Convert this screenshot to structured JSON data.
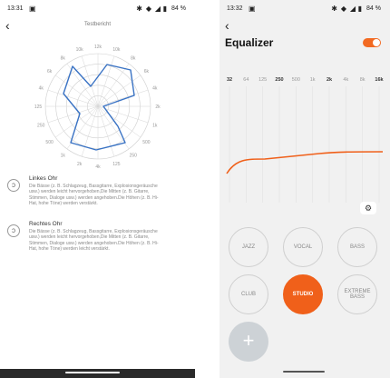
{
  "left": {
    "status": {
      "time": "13:31",
      "battery": "84 %"
    },
    "title": "Testbericht",
    "radar": {
      "labels": [
        "12k",
        "10k",
        "8k",
        "6k",
        "4k",
        "2k",
        "1k",
        "500",
        "250",
        "125",
        "4k",
        "2k",
        "1k",
        "500",
        "250",
        "125",
        "4k",
        "6k",
        "8k",
        "10k"
      ]
    },
    "left_ear": {
      "title": "Linkes Ohr",
      "text": "Die Bässe (z. B. Schlagzeug, Bassgitarre, Explosionsgeräusche usw.) werden leicht hervorgehoben,Die Mitten (z. B. Gitarre, Stimmen, Dialoge usw.) werden angehoben.Die Höhen (z. B. Hi-Hat, hohe Töne) werden verstärkt."
    },
    "right_ear": {
      "title": "Rechtes Ohr",
      "text": "Die Bässe (z. B. Schlagzeug, Bassgitarre, Explosionsgeräusche usw.) werden leicht hervorgehoben,Die Mitten (z. B. Gitarre, Stimmen, Dialoge usw.) werden angehoben.Die Höhen (z. B. Hi-Hat, hohe Töne) werden leicht verstärkt."
    }
  },
  "right": {
    "status": {
      "time": "13:32",
      "battery": "84 %"
    },
    "title": "Equalizer",
    "toggle_on": true,
    "frequencies": [
      {
        "label": "32",
        "bold": true
      },
      {
        "label": "64",
        "bold": false
      },
      {
        "label": "125",
        "bold": false
      },
      {
        "label": "250",
        "bold": true
      },
      {
        "label": "500",
        "bold": false
      },
      {
        "label": "1k",
        "bold": false
      },
      {
        "label": "2k",
        "bold": true
      },
      {
        "label": "4k",
        "bold": false
      },
      {
        "label": "8k",
        "bold": false
      },
      {
        "label": "16k",
        "bold": true
      }
    ],
    "presets": [
      {
        "label": "JAZZ",
        "active": false
      },
      {
        "label": "VOCAL",
        "active": false
      },
      {
        "label": "BASS",
        "active": false
      },
      {
        "label": "CLUB",
        "active": false
      },
      {
        "label": "STUDIO",
        "active": true
      },
      {
        "label": "EXTREME BASS",
        "active": false
      }
    ],
    "add_label": "+"
  },
  "colors": {
    "accent": "#f0601a",
    "radar_line": "#3a73c4"
  }
}
